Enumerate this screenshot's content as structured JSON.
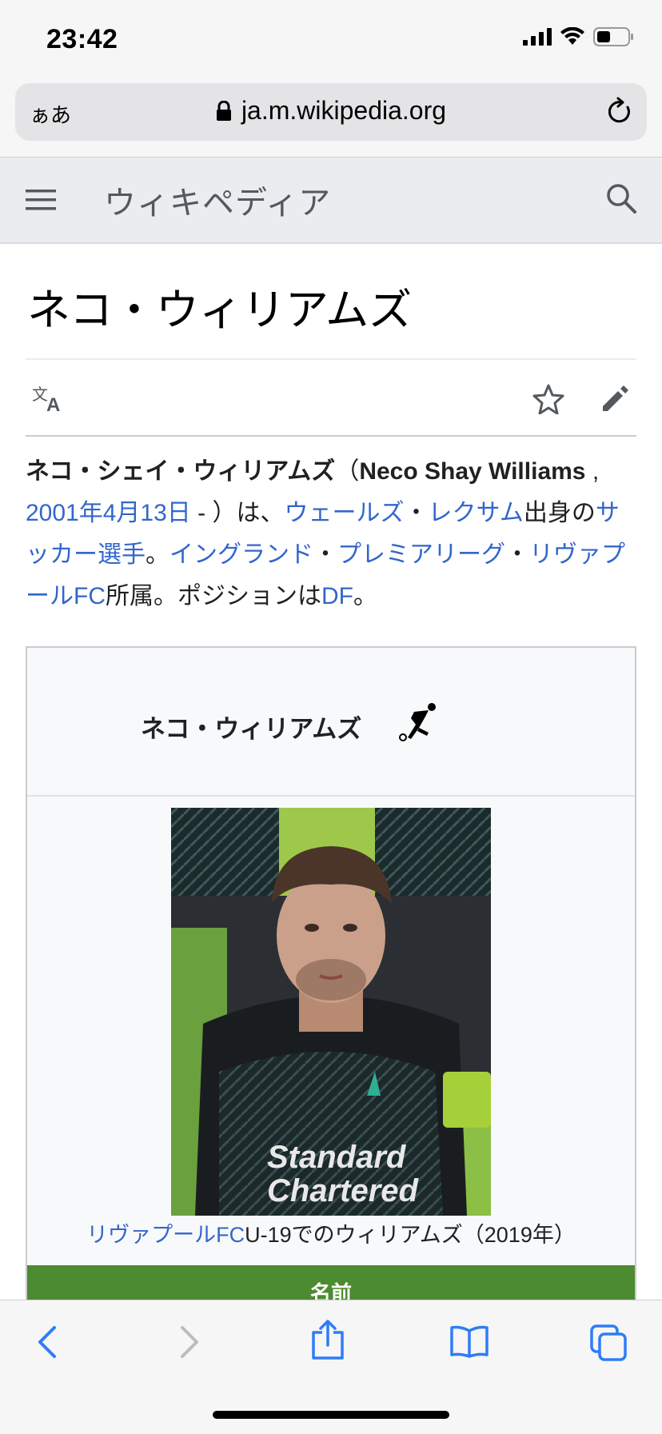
{
  "status": {
    "time": "23:42"
  },
  "browser": {
    "text_size_label": "ぁあ",
    "url": "ja.m.wikipedia.org"
  },
  "wiki": {
    "brand": "ウィキペディア"
  },
  "article": {
    "title": "ネコ・ウィリアムズ",
    "lead": {
      "name_ja": "ネコ・シェイ・ウィリアムズ",
      "paren_open": "（",
      "name_en": "Neco Shay Williams",
      "comma": " , ",
      "birth_date": "2001年4月13日",
      "dash": " - ）",
      "wa": "は、",
      "region": "ウェールズ",
      "dot1": "・",
      "city": "レクサム",
      "origin": "出身の",
      "occupation": "サッカー選手",
      "period": "。",
      "country": "イングランド",
      "dot2": "・",
      "league": "プレミアリーグ",
      "dot3": "・",
      "club": "リヴァプールFC",
      "affil": "所属。ポジションは",
      "position": "DF",
      "end": "。"
    },
    "infobox": {
      "name": "ネコ・ウィリアムズ",
      "caption_link": "リヴァプールFC",
      "caption_rest": "U-19でのウィリアムズ（2019年）",
      "section_label": "名前"
    }
  },
  "colors": {
    "link": "#3366cc",
    "infobox_header": "#4d8b31",
    "toolbar_icon": "#2f7cf6"
  }
}
